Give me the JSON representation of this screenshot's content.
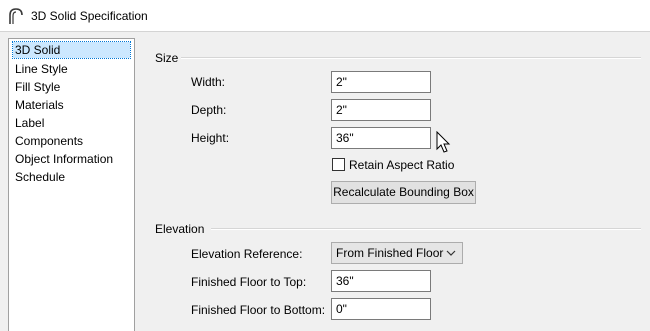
{
  "window": {
    "title": "3D Solid Specification",
    "icon": "arch-icon"
  },
  "sidebar": {
    "items": [
      {
        "label": "3D Solid",
        "selected": true
      },
      {
        "label": "Line Style"
      },
      {
        "label": "Fill Style"
      },
      {
        "label": "Materials"
      },
      {
        "label": "Label"
      },
      {
        "label": "Components"
      },
      {
        "label": "Object Information"
      },
      {
        "label": "Schedule"
      }
    ]
  },
  "size": {
    "heading": "Size",
    "width_label": "Width:",
    "width_value": "2\"",
    "depth_label": "Depth:",
    "depth_value": "2\"",
    "height_label": "Height:",
    "height_value": "36\"",
    "retain_label": "Retain Aspect Ratio",
    "retain_checked": false,
    "recalc_label": "Recalculate Bounding Box"
  },
  "elevation": {
    "heading": "Elevation",
    "reference_label": "Elevation Reference:",
    "reference_value": "From Finished Floor",
    "top_label": "Finished Floor to Top:",
    "top_value": "36\"",
    "bottom_label": "Finished Floor to Bottom:",
    "bottom_value": "0\""
  }
}
